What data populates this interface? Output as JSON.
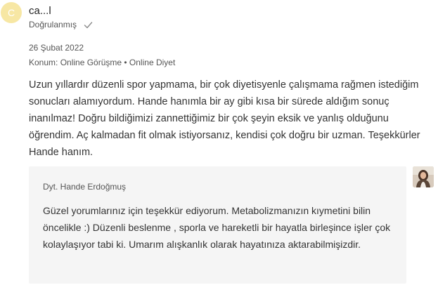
{
  "review": {
    "avatar_letter": "C",
    "username": "ca...l",
    "verified_label": "Doğrulanmış",
    "date": "26 Şubat 2022",
    "topic": "Konum: Online Görüşme • Online Diyet",
    "text": "Uzun yıllardır düzenli spor yapmama, bir çok diyetisyenle çalışmama rağmen istediğim sonucları alamıyordum. Hande hanımla bir ay gibi kısa bir sürede aldığım sonuç inanılmaz! Doğru bildiğimizi zannettiğimiz bir çok şeyin eksik ve yanlış olduğunu öğrendim. Aç kalmadan fit olmak istiyorsanız, kendisi çok doğru bir uzman. Teşekkürler Hande hanım."
  },
  "reply": {
    "author": "Dyt. Hande Erdoğmuş",
    "text": "Güzel yorumlarınız için teşekkür ediyorum. Metabolizmanızın kıymetini bilin öncelikle :) Düzenli beslenme , sporla ve hareketli bir hayatla birleşince işler çok kolaylaşıyor tabi ki. Umarım alışkanlık olarak hayatınıza aktarabilmişizdir."
  },
  "icons": {
    "verified": "check-icon",
    "reply_avatar": "doctor-photo"
  },
  "colors": {
    "avatar_bg": "#f7e7a4",
    "reply_bg": "#f5f5f5"
  }
}
